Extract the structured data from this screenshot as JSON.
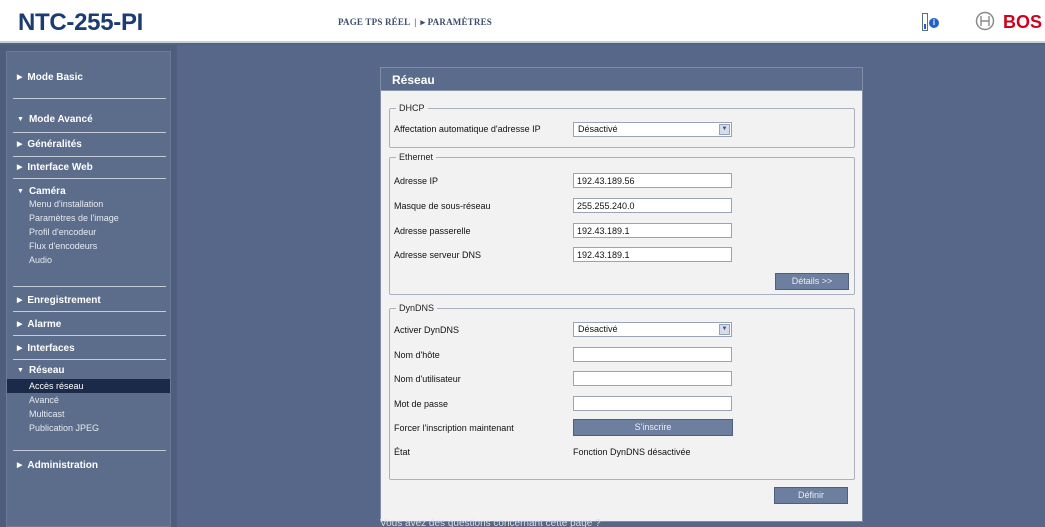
{
  "header": {
    "product": "NTC-255-PI",
    "nav_live": "PAGE TPS RÉEL",
    "nav_sep": "|",
    "nav_settings": "▸ PARAMÈTRES",
    "brand": "BOS"
  },
  "sidebar": {
    "mode_basic": "Mode Basic",
    "mode_advanced": "Mode Avancé",
    "general": "Généralités",
    "web_interface": "Interface Web",
    "camera": "Caméra",
    "camera_items": [
      "Menu d'installation",
      "Paramètres de l'image",
      "Profil d'encodeur",
      "Flux d'encodeurs",
      "Audio"
    ],
    "recording": "Enregistrement",
    "alarm": "Alarme",
    "interfaces": "Interfaces",
    "network": "Réseau",
    "network_items": [
      "Accès réseau",
      "Avancé",
      "Multicast",
      "Publication JPEG"
    ],
    "administration": "Administration"
  },
  "panel": {
    "title": "Réseau",
    "dhcp": {
      "legend": "DHCP",
      "label": "Affectation automatique d'adresse IP",
      "value": "Désactivé"
    },
    "ethernet": {
      "legend": "Ethernet",
      "ip_label": "Adresse IP",
      "ip_value": "192.43.189.56",
      "mask_label": "Masque de sous-réseau",
      "mask_value": "255.255.240.0",
      "gateway_label": "Adresse passerelle",
      "gateway_value": "192.43.189.1",
      "dns_label": "Adresse serveur DNS",
      "dns_value": "192.43.189.1",
      "details_button": "Détails >>"
    },
    "dyndns": {
      "legend": "DynDNS",
      "enable_label": "Activer DynDNS",
      "enable_value": "Désactivé",
      "hostname_label": "Nom d'hôte",
      "hostname_value": "",
      "username_label": "Nom d'utilisateur",
      "username_value": "",
      "password_label": "Mot de passe",
      "password_value": "",
      "force_label": "Forcer l'inscription maintenant",
      "register_button": "S'inscrire",
      "status_label": "État",
      "status_value": "Fonction DynDNS désactivée"
    },
    "submit_button": "Définir"
  },
  "footer": {
    "question": "Vous avez des questions concernant cette page ?"
  },
  "colors": {
    "brand_red": "#d0021b",
    "title_blue": "#1b3c73",
    "background": "#516282"
  }
}
